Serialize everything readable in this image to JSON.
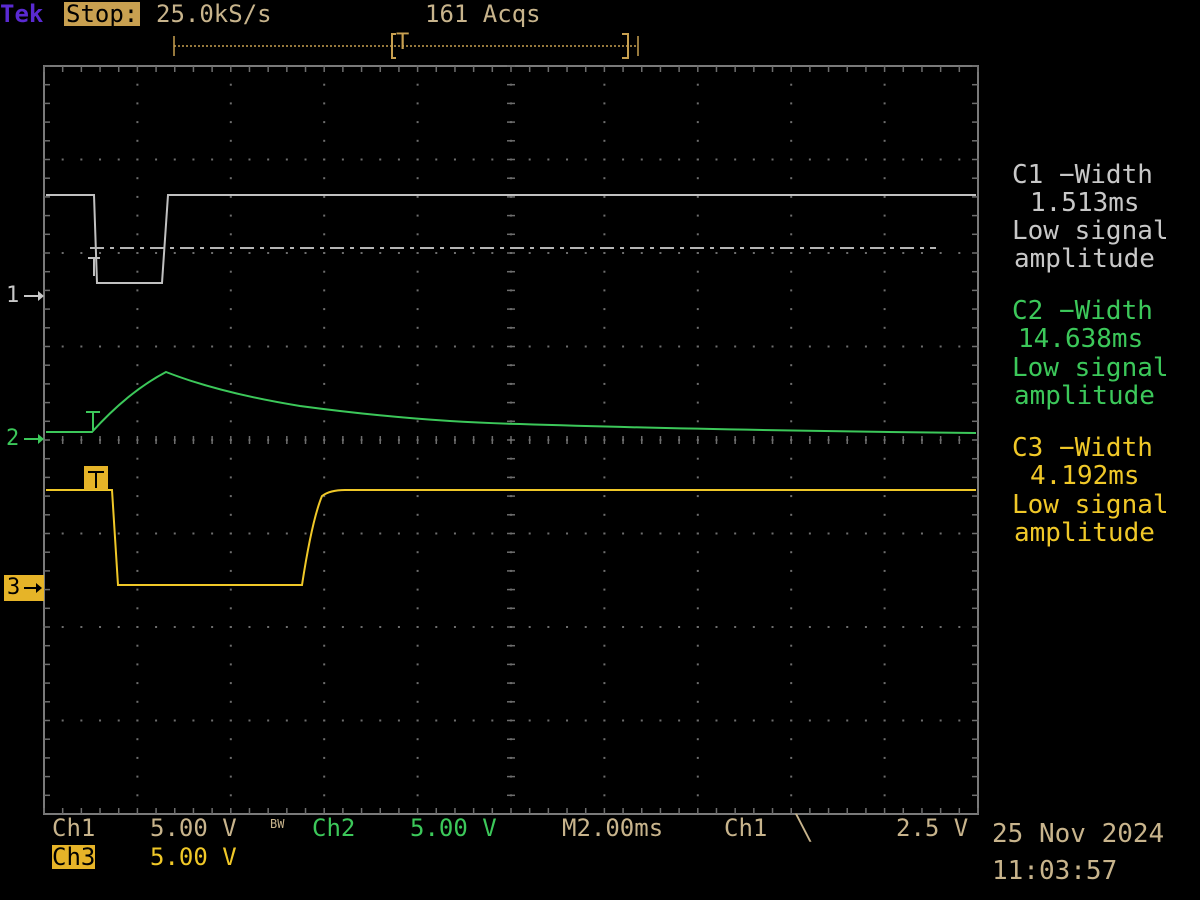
{
  "header": {
    "brand": "Tek",
    "run_state": "Stop:",
    "sample_rate": "25.0kS/s",
    "acquisitions": "161 Acqs"
  },
  "channels": {
    "ch1_marker": "1",
    "ch2_marker": "2",
    "ch3_marker": "3",
    "ch1_color": "#c8c8c8",
    "ch2_color": "#3cc85a",
    "ch3_color": "#f0c828"
  },
  "measurements": [
    {
      "title": "C1 −Width",
      "value": "1.513ms",
      "line3": "Low signal",
      "line4": "amplitude"
    },
    {
      "title": "C2 −Width",
      "value": "14.638ms",
      "line3": "Low signal",
      "line4": "amplitude"
    },
    {
      "title": "C3 −Width",
      "value": "4.192ms",
      "line3": "Low signal",
      "line4": "amplitude"
    }
  ],
  "status": {
    "ch1_label": "Ch1",
    "ch1_scale": "5.00 V",
    "bw_mark": "BW",
    "ch2_label": "Ch2",
    "ch2_scale": "5.00 V",
    "timebase": "M2.00ms",
    "trigger_source": "Ch1",
    "trigger_slope": "╲",
    "trigger_level": "2.5 V",
    "ch3_label": "Ch3",
    "ch3_scale": "5.00 V",
    "date": "25 Nov 2024",
    "time": "11:03:57"
  },
  "trigger_marker": "T"
}
